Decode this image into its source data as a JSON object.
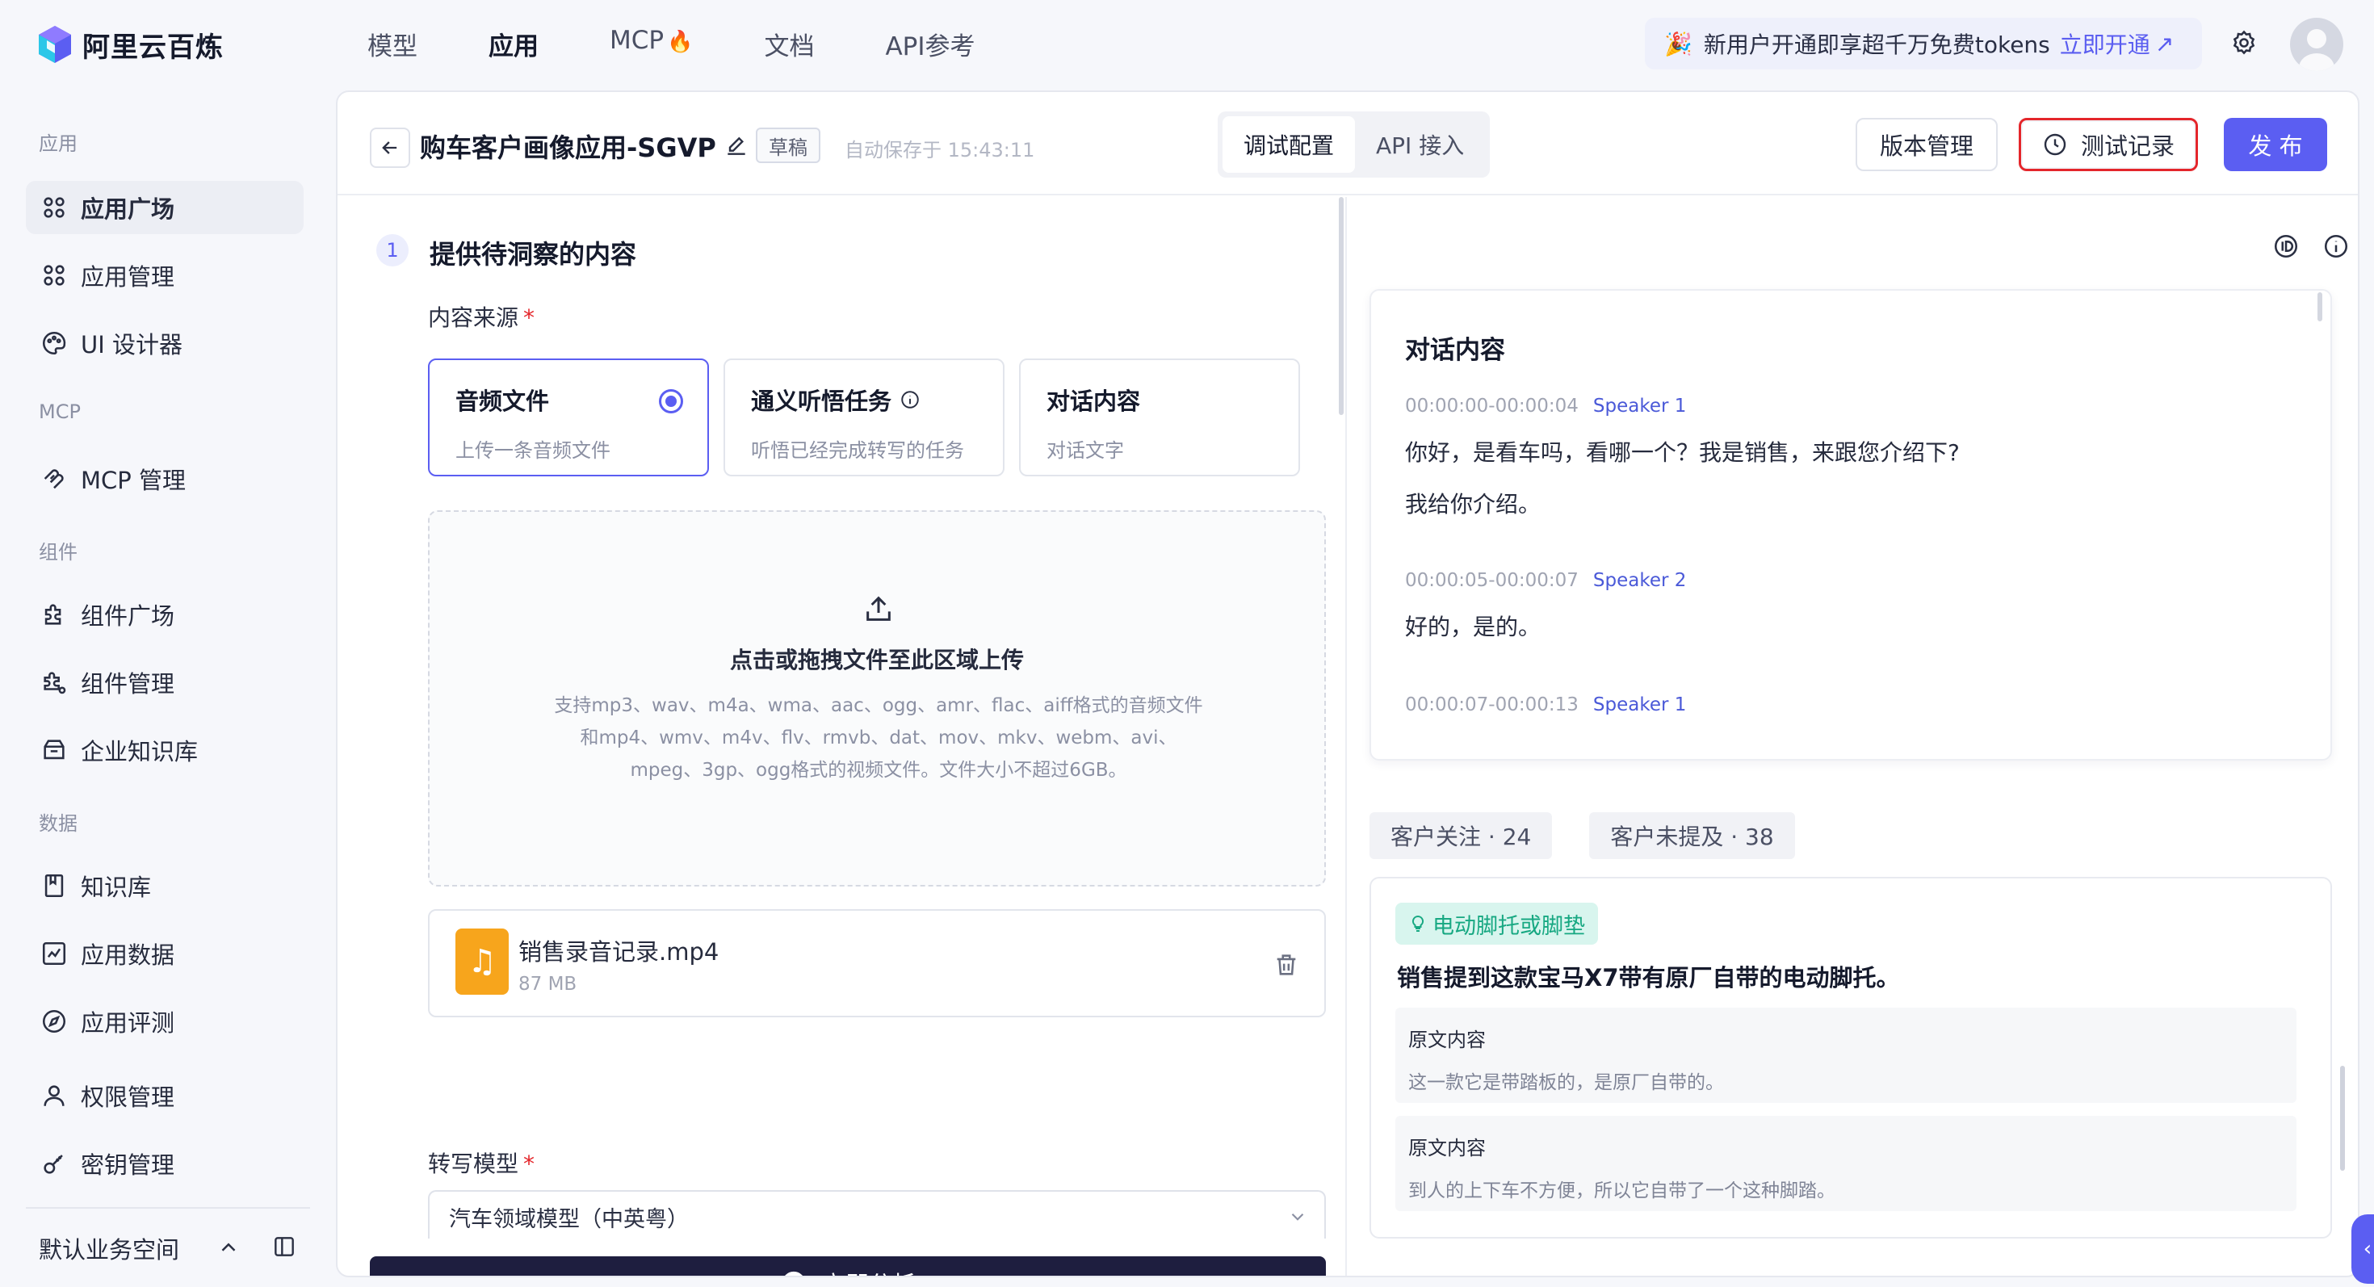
{
  "app": {
    "logo_text": "阿里云百炼",
    "brand_color": "#5b5ef2"
  },
  "nav": {
    "items": [
      "模型",
      "应用",
      "MCP",
      "文档",
      "API参考"
    ],
    "active": "应用",
    "mcp_badge_icon": "fire-icon"
  },
  "promo": {
    "text": "新用户开通即享超千万免费tokens",
    "cta": "立即开通"
  },
  "sidebar": {
    "sections": [
      "应用",
      "MCP",
      "组件",
      "数据"
    ],
    "items": [
      {
        "label": "应用广场",
        "icon": "grid-icon",
        "active": true
      },
      {
        "label": "应用管理",
        "icon": "grid-icon"
      },
      {
        "label": "UI 设计器",
        "icon": "palette-icon"
      },
      {
        "label": "MCP 管理",
        "icon": "mcp-icon"
      },
      {
        "label": "组件广场",
        "icon": "puzzle-icon"
      },
      {
        "label": "组件管理",
        "icon": "puzzle-gear-icon"
      },
      {
        "label": "企业知识库",
        "icon": "archive-icon"
      },
      {
        "label": "知识库",
        "icon": "book-icon"
      },
      {
        "label": "应用数据",
        "icon": "chart-icon"
      },
      {
        "label": "应用评测",
        "icon": "compass-icon"
      },
      {
        "label": "权限管理",
        "icon": "user-icon"
      },
      {
        "label": "密钥管理",
        "icon": "key-icon"
      }
    ],
    "workspace": "默认业务空间"
  },
  "header": {
    "title": "购车客户画像应用-SGVP",
    "badge": "草稿",
    "autosave": "自动保存于 15:43:11",
    "tabs": [
      "调试配置",
      "API 接入"
    ],
    "active_tab": "调试配置",
    "btn_version": "版本管理",
    "btn_test": "测试记录",
    "btn_publish": "发 布"
  },
  "step": {
    "number": "1",
    "title": "提供待洞察的内容",
    "source_label": "内容来源",
    "required_mark": "*",
    "options": [
      {
        "title": "音频文件",
        "sub": "上传一条音频文件"
      },
      {
        "title": "通义听悟任务",
        "sub": "听悟已经完成转写的任务"
      },
      {
        "title": "对话内容",
        "sub": "对话文字"
      }
    ],
    "upload": {
      "title": "点击或拖拽文件至此区域上传",
      "desc": "支持mp3、wav、m4a、wma、aac、ogg、amr、flac、aiff格式的音频文件和mp4、wmv、m4v、flv、rmvb、dat、mov、mkv、webm、avi、mpeg、3gp、ogg格式的视频文件。文件大小不超过6GB。"
    },
    "file": {
      "name": "销售录音记录.mp4",
      "size": "87 MB"
    },
    "model_label": "转写模型",
    "model_value": "汽车领域模型（中英粤）",
    "analyze_btn": "立即分析"
  },
  "conversation": {
    "title": "对话内容",
    "segments": [
      {
        "time": "00:00:00-00:00:04",
        "speaker": "Speaker 1",
        "lines": [
          "你好，是看车吗，看哪一个？我是销售，来跟您介绍下?",
          "我给你介绍。"
        ]
      },
      {
        "time": "00:00:05-00:00:07",
        "speaker": "Speaker 2",
        "lines": [
          "好的，是的。"
        ]
      },
      {
        "time": "00:00:07-00:00:13",
        "speaker": "Speaker 1",
        "lines": []
      }
    ]
  },
  "insights": {
    "tabs": [
      "客户关注 · 24",
      "客户未提及 · 38"
    ],
    "tag": "电动脚托或脚垫",
    "summary": "销售提到这款宝马X7带有原厂自带的电动脚托。",
    "quotes": [
      {
        "label": "原文内容",
        "text": "这一款它是带踏板的，是原厂自带的。"
      },
      {
        "label": "原文内容",
        "text": "到人的上下车不方便，所以它自带了一个这种脚踏。"
      }
    ]
  }
}
